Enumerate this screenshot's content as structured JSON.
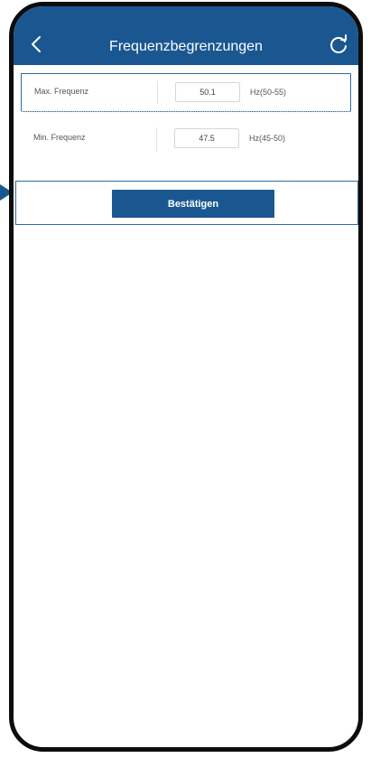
{
  "header": {
    "title": "Frequenzbegrenzungen",
    "back_icon": "chevron-left-icon",
    "refresh_icon": "refresh-icon"
  },
  "settings": {
    "max": {
      "label": "Max. Frequenz",
      "value": "50.1",
      "unit": "Hz(50-55)"
    },
    "min": {
      "label": "Min. Frequenz",
      "value": "47.5",
      "unit": "Hz(45-50)"
    }
  },
  "confirm_label": "Bestätigen",
  "colors": {
    "brand": "#1a5791",
    "highlight": "#2f6aa5"
  }
}
